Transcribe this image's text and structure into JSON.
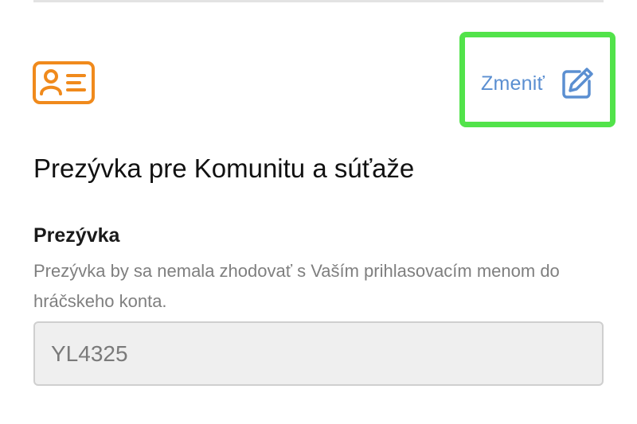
{
  "header": {
    "card_icon": "id-card-icon",
    "edit": {
      "label": "Zmeniť",
      "icon": "edit-pencil-icon",
      "highlight_color": "#52e34a",
      "link_color": "#5b8fd1"
    }
  },
  "section": {
    "title": "Prezývka pre Komunitu a súťaže"
  },
  "nickname_field": {
    "label": "Prezývka",
    "help": "Prezývka by sa nemala zhodovať s Vaším prihlasovacím menom do hráčskeho konta.",
    "value": "YL4325"
  },
  "colors": {
    "accent_orange": "#f08a1c"
  }
}
